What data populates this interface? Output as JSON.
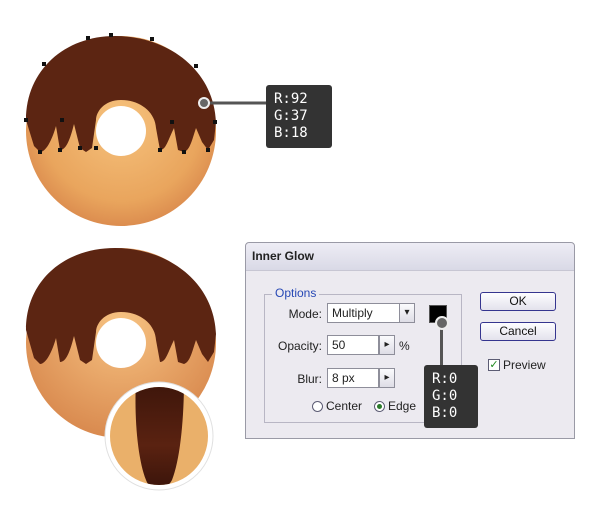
{
  "colors": {
    "chocolate": "#5c2512",
    "dough": "#e7a766",
    "callout_bg": "#333333",
    "glow_color": "#000000"
  },
  "callout_top": {
    "r": "R:92",
    "g": "G:37",
    "b": "B:18"
  },
  "callout_dialog": {
    "r": "R:0",
    "g": "G:0",
    "b": "B:0"
  },
  "dialog": {
    "title": "Inner Glow",
    "options_legend": "Options",
    "mode_label": "Mode:",
    "mode_value": "Multiply",
    "opacity_label": "Opacity:",
    "opacity_value": "50",
    "opacity_unit": "%",
    "blur_label": "Blur:",
    "blur_value": "8 px",
    "center_label": "Center",
    "edge_label": "Edge",
    "ok_label": "OK",
    "cancel_label": "Cancel",
    "preview_label": "Preview",
    "preview_checked": true,
    "selected_radio": "Edge"
  },
  "icons": {
    "dropdown": "chevron-down-icon",
    "stepper": "chevron-right-icon",
    "check": "checkmark-icon"
  }
}
